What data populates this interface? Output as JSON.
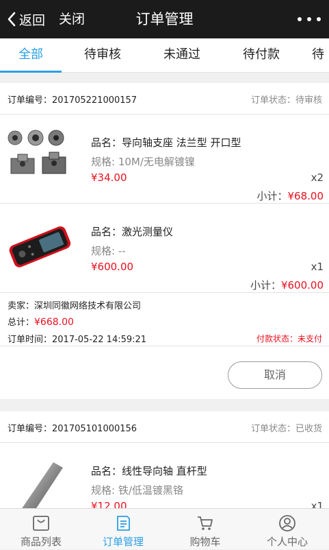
{
  "header": {
    "back_label": "返回",
    "close_label": "关闭",
    "title": "订单管理"
  },
  "tabs": [
    {
      "label": "全部",
      "active": true
    },
    {
      "label": "待审核"
    },
    {
      "label": "未通过"
    },
    {
      "label": "待付款"
    },
    {
      "label": "待"
    }
  ],
  "orders": [
    {
      "number": "订单编号：201705221000157",
      "status": "订单状态：待审核",
      "products": [
        {
          "name": "品名：导向轴支座 法兰型 开口型",
          "spec": "规格:    10M/无电解镀镍",
          "price": "¥34.00",
          "qty": "x2",
          "subtotal_label": "小计：",
          "subtotal_value": "¥68.00"
        },
        {
          "name": "品名：激光测量仪",
          "spec": "规格:    --",
          "price": "¥600.00",
          "qty": "x1",
          "subtotal_label": "小计：",
          "subtotal_value": "¥600.00"
        }
      ],
      "seller": "卖家：深圳同徽网络技术有限公司",
      "total_label": "总计：",
      "total_value": "¥668.00",
      "time": "订单时间：2017-05-22 14:59:21",
      "pay_status": "付款状态：未支付",
      "cancel_label": "取消"
    },
    {
      "number": "订单编号：201705101000156",
      "status": "订单状态：已收货",
      "products": [
        {
          "name": "品名：线性导向轴 直杆型",
          "spec": "规格:    铁/低温镀黑铬",
          "price": "¥12.00",
          "qty": "x1"
        }
      ]
    }
  ],
  "bottom_nav": [
    {
      "label": "商品列表",
      "icon": "bag-icon"
    },
    {
      "label": "订单管理",
      "icon": "order-document-icon",
      "active": true
    },
    {
      "label": "购物车",
      "icon": "cart-icon"
    },
    {
      "label": "个人中心",
      "icon": "user-circle-icon"
    }
  ],
  "colors": {
    "accent": "#2aa0e6",
    "price_red": "#e8101e",
    "topbar": "#1b1b1b"
  }
}
